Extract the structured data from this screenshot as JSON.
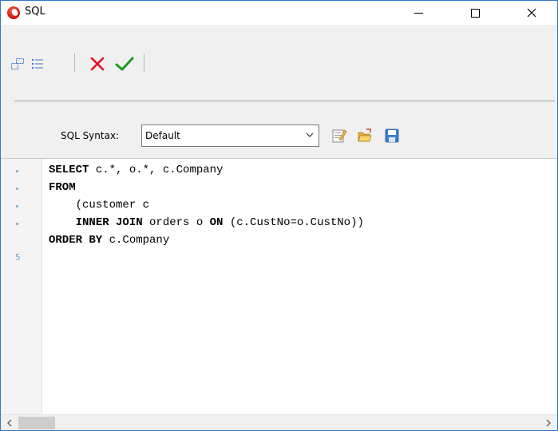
{
  "window": {
    "title": "SQL",
    "controls": {
      "minimize": "minimize",
      "maximize": "maximize",
      "close": "close"
    }
  },
  "toolbar": {
    "icons": [
      "restore-layout-icon",
      "list-icon",
      "cancel-icon",
      "ok-icon"
    ]
  },
  "syntax": {
    "label": "SQL Syntax:",
    "selected": "Default",
    "buttons": [
      "edit-syntax-icon",
      "open-folder-icon",
      "save-icon"
    ]
  },
  "editor": {
    "line_markers": [
      "•",
      "•",
      "•",
      "•",
      "5"
    ],
    "lines": [
      [
        {
          "t": "SELECT",
          "k": true
        },
        {
          "t": " c.*, o.*, c.Company",
          "k": false
        }
      ],
      [
        {
          "t": "FROM",
          "k": true
        }
      ],
      [
        {
          "t": "    (customer c",
          "k": false
        }
      ],
      [
        {
          "t": "    ",
          "k": false
        },
        {
          "t": "INNER JOIN",
          "k": true
        },
        {
          "t": " orders o ",
          "k": false
        },
        {
          "t": "ON",
          "k": true
        },
        {
          "t": " (c.CustNo=o.CustNo))",
          "k": false
        }
      ],
      [
        {
          "t": "ORDER BY",
          "k": true
        },
        {
          "t": " c.Company",
          "k": false
        }
      ]
    ]
  },
  "colors": {
    "accent": "#2b79c9",
    "cancel_red": "#e81123",
    "ok_green": "#1e9a1e"
  }
}
